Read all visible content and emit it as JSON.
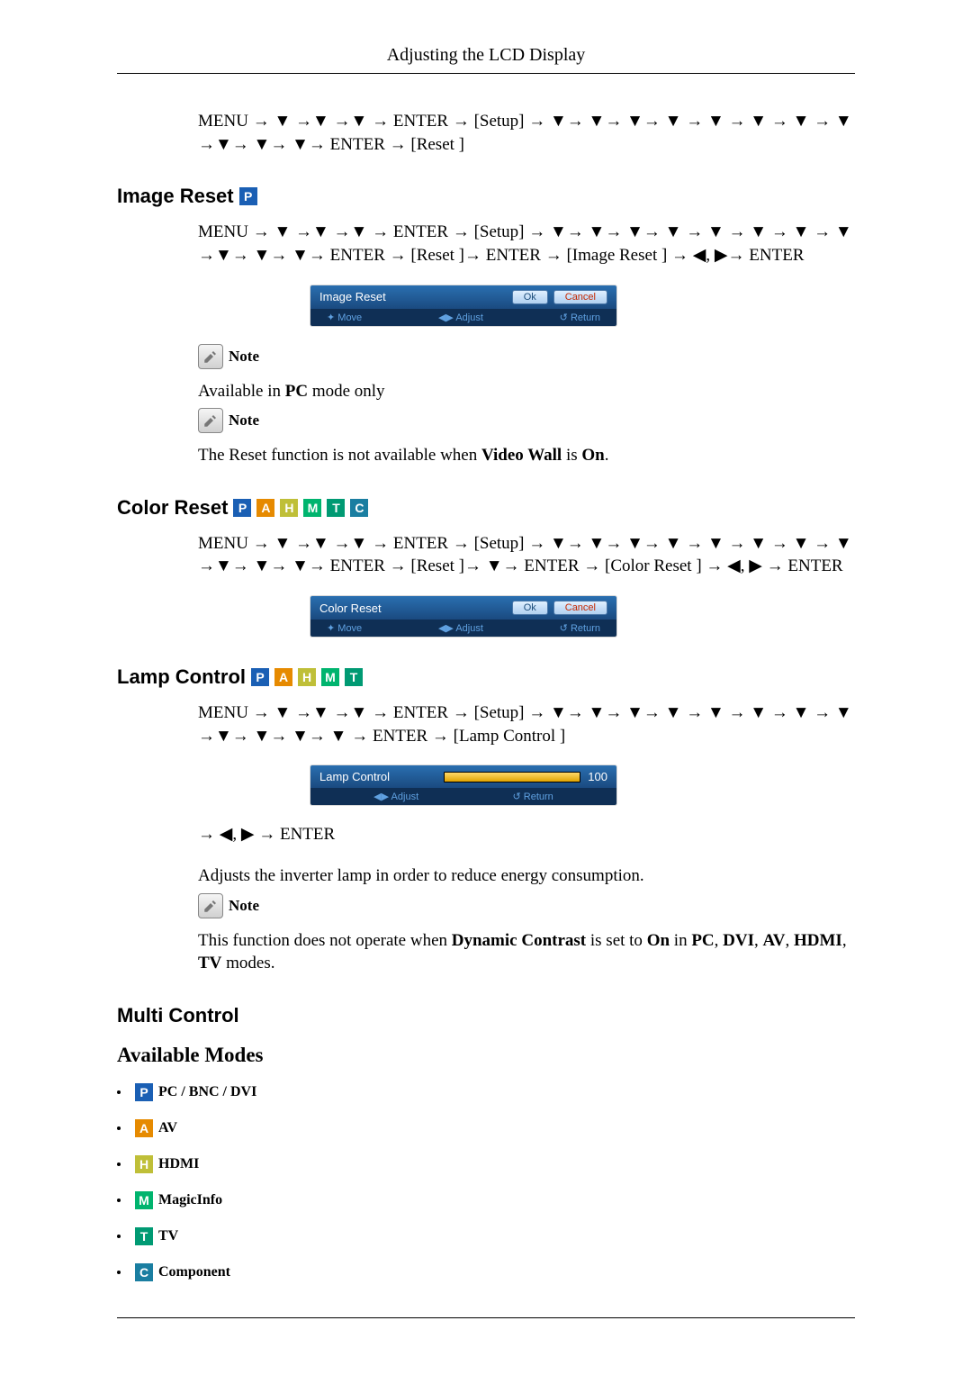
{
  "header": {
    "title": "Adjusting the LCD Display"
  },
  "top_sequence": "MENU → ▼ →▼ →▼ → ENTER → [Setup] → ▼→ ▼→ ▼→ ▼ → ▼ → ▼ → ▼ → ▼ →▼→ ▼→ ▼→ ENTER → [Reset ]",
  "image_reset": {
    "title": "Image Reset",
    "badges": [
      "P"
    ],
    "sequence": "MENU → ▼ →▼ →▼ → ENTER → [Setup] → ▼→ ▼→ ▼→ ▼ → ▼ → ▼ → ▼ → ▼ →▼→ ▼→ ▼→ ENTER → [Reset ]→ ENTER → [Image Reset ] → ◀, ▶→ ENTER",
    "osd": {
      "label": "Image Reset",
      "ok": "Ok",
      "cancel": "Cancel",
      "hint_move": "Move",
      "hint_adjust": "Adjust",
      "hint_return": "Return"
    },
    "note1_label": "Note",
    "note1_text_a": "Available in ",
    "note1_text_b": "PC",
    "note1_text_c": " mode only",
    "note2_label": "Note",
    "note2_text_a": "The Reset function is not available when ",
    "note2_text_b": "Video Wall",
    "note2_text_c": " is ",
    "note2_text_d": "On",
    "note2_text_e": "."
  },
  "color_reset": {
    "title": "Color Reset",
    "badges": [
      "P",
      "A",
      "H",
      "M",
      "T",
      "C"
    ],
    "sequence": "MENU → ▼ →▼ →▼ → ENTER → [Setup] → ▼→ ▼→ ▼→ ▼ → ▼ → ▼ → ▼ → ▼ →▼→ ▼→ ▼→ ENTER → [Reset ]→ ▼→ ENTER → [Color Reset ] → ◀, ▶ → ENTER",
    "osd": {
      "label": "Color Reset",
      "ok": "Ok",
      "cancel": "Cancel",
      "hint_move": "Move",
      "hint_adjust": "Adjust",
      "hint_return": "Return"
    }
  },
  "lamp_control": {
    "title": "Lamp Control",
    "badges": [
      "P",
      "A",
      "H",
      "M",
      "T"
    ],
    "sequence": "MENU → ▼ →▼ →▼ → ENTER → [Setup] → ▼→ ▼→ ▼→ ▼ → ▼ → ▼ → ▼ → ▼ →▼→ ▼→ ▼→ ▼ → ENTER → [Lamp Control ]",
    "osd": {
      "label": "Lamp Control",
      "value": "100",
      "hint_adjust": "Adjust",
      "hint_return": "Return"
    },
    "after_seq": "→ ◀, ▶ → ENTER",
    "desc": "Adjusts the inverter lamp in order to reduce energy consumption.",
    "note_label": "Note",
    "note_text_a": "This function does not operate when ",
    "note_text_b": "Dynamic Contrast",
    "note_text_c": " is set to ",
    "note_text_d": "On",
    "note_text_e": " in ",
    "note_text_f": "PC",
    "note_text_g": ", ",
    "note_text_h": "DVI",
    "note_text_i": ", ",
    "note_text_j": "AV",
    "note_text_k": ", ",
    "note_text_l": "HDMI",
    "note_text_m": ", ",
    "note_text_n": "TV",
    "note_text_o": " modes."
  },
  "multi_control": {
    "title": "Multi Control",
    "subtitle": "Available Modes",
    "modes": [
      {
        "badge": "P",
        "label": "PC / BNC / DVI"
      },
      {
        "badge": "A",
        "label": "AV"
      },
      {
        "badge": "H",
        "label": "HDMI"
      },
      {
        "badge": "M",
        "label": "MagicInfo"
      },
      {
        "badge": "T",
        "label": "TV"
      },
      {
        "badge": "C",
        "label": "Component"
      }
    ]
  }
}
